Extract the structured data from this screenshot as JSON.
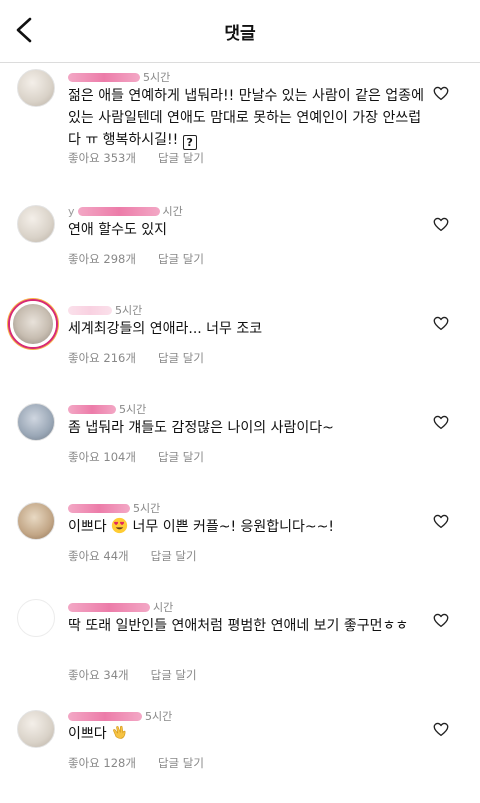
{
  "header": {
    "title": "댓글"
  },
  "comments": [
    {
      "user_visible": "",
      "time": "5시간",
      "text": "젊은 애들 연예하게 냅둬라!! 만날수 있는 사람이 같은 업종에 있는 사람일텐데 연애도 맘대로 못하는 연예인이 가장 안쓰럽다 ㅠ 행복하시길!!",
      "likes": "좋아요 353개",
      "reply": "답글 달기"
    },
    {
      "user_visible": "y",
      "time": "시간",
      "text": "연애 할수도 있지",
      "likes": "좋아요 298개",
      "reply": "답글 달기"
    },
    {
      "user_visible": "",
      "time": "5시간",
      "text": "세계최강들의 연애라... 너무 조코",
      "likes": "좋아요 216개",
      "reply": "답글 달기"
    },
    {
      "user_visible": "",
      "time": "5시간",
      "text": "좀 냅둬라 걔들도 감정많은 나이의 사람이다~",
      "likes": "좋아요 104개",
      "reply": "답글 달기"
    },
    {
      "user_visible": "",
      "time": "5시간",
      "text_a": "이쁘다",
      "text_b": " 너무 이쁜 커플~! 응원합니다~~!",
      "likes": "좋아요 44개",
      "reply": "답글 달기"
    },
    {
      "user_visible": "",
      "time": "시간",
      "text": "딱 또래 일반인들 연애처럼 평범한 연애네 보기 좋구먼ㅎㅎ",
      "likes": "좋아요 34개",
      "reply": "답글 달기"
    },
    {
      "user_visible": "",
      "time": "5시간",
      "text": "이쁘다",
      "likes": "좋아요 128개",
      "reply": "답글 달기"
    }
  ],
  "icons": {
    "back": "chevron-left-icon",
    "heart": "heart-outline-icon",
    "emoji_heart_eyes": "heart-eyes-emoji-icon",
    "emoji_clap": "clapping-hands-emoji-icon",
    "unknown_glyph": "?"
  }
}
